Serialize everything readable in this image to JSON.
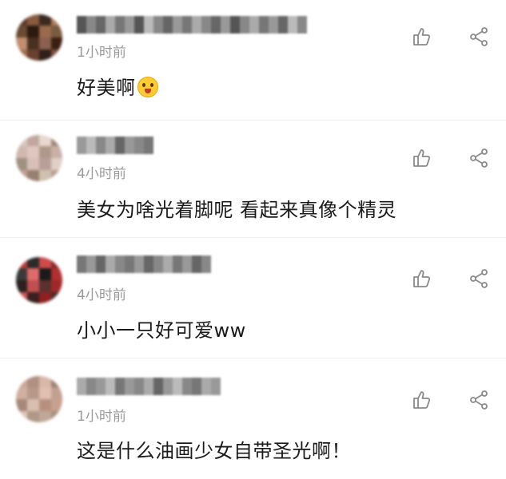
{
  "comments": [
    {
      "time": "1小时前",
      "text": "好美啊",
      "emoji": "grinning-tears-emoji",
      "avatar_colors": [
        "#5a3a2a",
        "#8a5a40",
        "#3a2a20",
        "#b07a5a",
        "#6a4a30",
        "#2a1a10",
        "#9a6a4a",
        "#7a5a40",
        "#c09070",
        "#4a3020",
        "#8a6050",
        "#3a2010",
        "#a07050",
        "#6a4030",
        "#302018",
        "#805040"
      ],
      "name_colors": [
        "#555",
        "#888",
        "#666",
        "#aaa",
        "#777",
        "#999",
        "#555",
        "#bbb",
        "#888",
        "#666",
        "#999",
        "#777",
        "#aaa",
        "#888",
        "#666",
        "#999",
        "#555",
        "#888",
        "#aaa",
        "#777",
        "#999",
        "#666",
        "#bbb",
        "#888"
      ]
    },
    {
      "time": "4小时前",
      "text": "美女为啥光着脚呢 看起来真像个精灵",
      "avatar_colors": [
        "#d8c8c0",
        "#c0a8a0",
        "#e8d8d0",
        "#a08878",
        "#d0b8b0",
        "#e0c8c0",
        "#b09888",
        "#c8b0a8",
        "#a09080",
        "#d8c0b8",
        "#b8a098",
        "#e0d0c8",
        "#c0a090",
        "#988070",
        "#d0c0b0",
        "#b8a090"
      ],
      "name_colors": [
        "#999",
        "#bbb",
        "#888",
        "#aaa",
        "#666",
        "#999",
        "#888",
        "#777"
      ]
    },
    {
      "time": "4小时前",
      "text": "小小一只好可爱ww",
      "avatar_colors": [
        "#c03a3a",
        "#2a2a2a",
        "#d04a4a",
        "#8a2a2a",
        "#3a3a3a",
        "#e06a6a",
        "#1a1a1a",
        "#b03030",
        "#2a2020",
        "#c05050",
        "#5a3030",
        "#a02828",
        "#d05a5a",
        "#3a2020",
        "#902020",
        "#4a2a2a"
      ],
      "name_colors": [
        "#777",
        "#999",
        "#666",
        "#aaa",
        "#888",
        "#777",
        "#999",
        "#666",
        "#888",
        "#aaa",
        "#777",
        "#999",
        "#666",
        "#888"
      ]
    },
    {
      "time": "1小时前",
      "text": "这是什么油画少女自带圣光啊！",
      "avatar_colors": [
        "#c8a898",
        "#b09080",
        "#d8b8a8",
        "#a08070",
        "#d0b0a0",
        "#b89888",
        "#e0c0b0",
        "#c0a090",
        "#a88878",
        "#d8c0b0",
        "#b89080",
        "#c8a090",
        "#e0c8b8",
        "#b09888",
        "#c0a898",
        "#a89080"
      ],
      "name_colors": [
        "#aaa",
        "#888",
        "#999",
        "#bbb",
        "#777",
        "#999",
        "#888",
        "#aaa",
        "#666",
        "#999",
        "#bbb",
        "#888",
        "#777",
        "#aaa",
        "#999"
      ]
    }
  ],
  "icons": {
    "like": "thumbs-up-icon",
    "share": "share-icon"
  },
  "colors": {
    "time": "#9a9a9a",
    "text": "#1a1a1a",
    "icon": "#8a8a8a",
    "divider": "#eeeeee"
  }
}
